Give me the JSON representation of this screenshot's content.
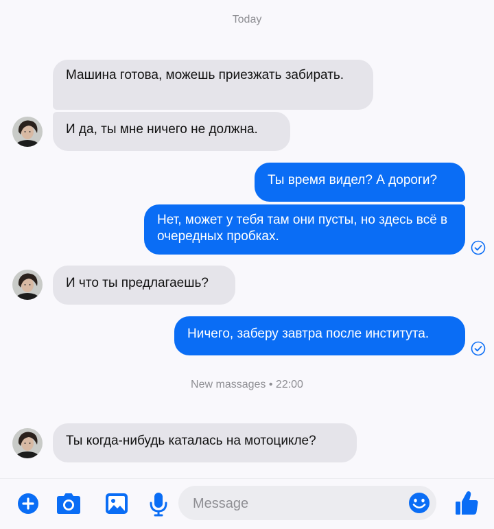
{
  "separators": {
    "today": "Today",
    "new_messages": "New massages • 22:00"
  },
  "messages": [
    {
      "from": "them",
      "text": "Машина готова, можешь приезжать забирать."
    },
    {
      "from": "them",
      "text": "И да, ты мне ничего не должна."
    },
    {
      "from": "me",
      "text": "Ты время видел? А дороги?"
    },
    {
      "from": "me",
      "text": "Нет, может у тебя там они пусты, но здесь всё в очередных пробках."
    },
    {
      "from": "them",
      "text": "И что ты предлагаешь?"
    },
    {
      "from": "me",
      "text": "Ничего, заберу завтра после института."
    },
    {
      "from": "them",
      "text": "Ты когда-нибудь каталась на мотоцикле?"
    }
  ],
  "composer": {
    "placeholder": "Message",
    "icons": [
      "plus-icon",
      "camera-icon",
      "image-icon",
      "microphone-icon",
      "emoji-icon",
      "thumbs-up-icon"
    ]
  },
  "colors": {
    "accent": "#0a6df5",
    "incoming_bubble": "#e5e4ea",
    "background": "#f9f8fc"
  }
}
